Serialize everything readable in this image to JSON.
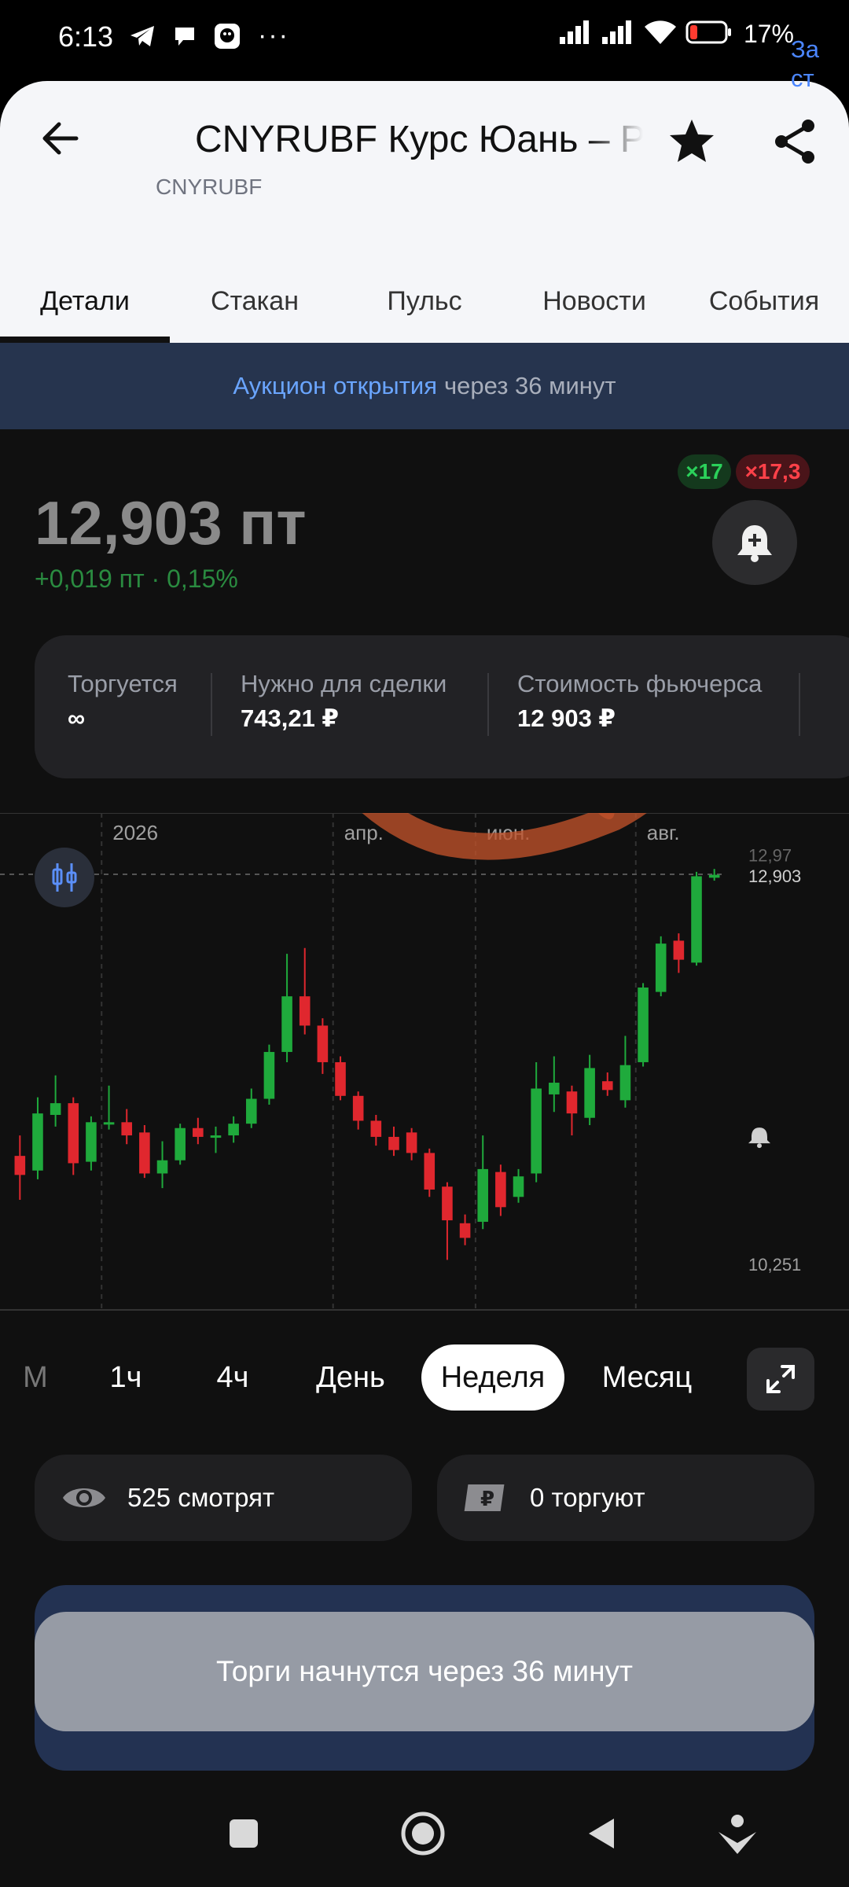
{
  "status_bar": {
    "time": "6:13",
    "battery_text": "17%",
    "icons": [
      "telegram-icon",
      "chat-bubble-icon",
      "app-icon",
      "more-dots-icon",
      "signal-icon",
      "signal-icon",
      "wifi-icon",
      "battery-icon"
    ],
    "more_dots": "···"
  },
  "header": {
    "title": "CNYRUBF Курс Юань – Р",
    "ticker": "CNYRUBF",
    "icons": [
      "arrow-left-icon",
      "star-icon",
      "share-icon"
    ]
  },
  "tabs": [
    {
      "label": "Детали",
      "active": true
    },
    {
      "label": "Стакан",
      "active": false
    },
    {
      "label": "Пульс",
      "active": false
    },
    {
      "label": "Новости",
      "active": false
    },
    {
      "label": "События",
      "active": false
    }
  ],
  "auction_banner": {
    "link_text": "Аукцион открытия",
    "rest_text": "через 36 минут"
  },
  "badges": {
    "green": "×17",
    "red": "×17,3"
  },
  "quote": {
    "price": "12,903 пт",
    "change": "+0,019 пт · 0,15%",
    "colors": {
      "price": "#8a8a8a",
      "change": "#2a8b40"
    }
  },
  "info_card": {
    "items": [
      {
        "label": "Торгуется",
        "value": "∞"
      },
      {
        "label": "Нужно для сделки",
        "value": "743,21 ₽"
      },
      {
        "label": "Стоимость фьючерса",
        "value": "12 903 ₽"
      }
    ],
    "cut_link": "За ст"
  },
  "chart_data": {
    "type": "candlestick",
    "x_labels": [
      "2026",
      "апр.",
      "июн.",
      "авг."
    ],
    "y_labels": [
      "12,97",
      "12,903",
      "10,251"
    ],
    "ylim": [
      10.1,
      13.0
    ],
    "colors": {
      "up": "#1faa3c",
      "down": "#e0272e",
      "bg": "#101010",
      "grid": "#333333"
    },
    "candles": [
      {
        "o": 10.98,
        "c": 10.85,
        "h": 11.12,
        "l": 10.68
      },
      {
        "o": 10.88,
        "c": 11.27,
        "h": 11.38,
        "l": 10.82
      },
      {
        "o": 11.26,
        "c": 11.34,
        "h": 11.53,
        "l": 11.18
      },
      {
        "o": 11.34,
        "c": 10.93,
        "h": 11.38,
        "l": 10.85
      },
      {
        "o": 10.94,
        "c": 11.21,
        "h": 11.25,
        "l": 10.88
      },
      {
        "o": 11.2,
        "c": 11.21,
        "h": 11.46,
        "l": 11.16
      },
      {
        "o": 11.21,
        "c": 11.12,
        "h": 11.3,
        "l": 11.06
      },
      {
        "o": 11.14,
        "c": 10.86,
        "h": 11.19,
        "l": 10.83
      },
      {
        "o": 10.86,
        "c": 10.95,
        "h": 11.08,
        "l": 10.76
      },
      {
        "o": 10.95,
        "c": 11.17,
        "h": 11.2,
        "l": 10.92
      },
      {
        "o": 11.17,
        "c": 11.11,
        "h": 11.24,
        "l": 11.06
      },
      {
        "o": 11.11,
        "c": 11.12,
        "h": 11.18,
        "l": 11.0
      },
      {
        "o": 11.12,
        "c": 11.2,
        "h": 11.25,
        "l": 11.07
      },
      {
        "o": 11.2,
        "c": 11.37,
        "h": 11.44,
        "l": 11.17
      },
      {
        "o": 11.37,
        "c": 11.69,
        "h": 11.74,
        "l": 11.33
      },
      {
        "o": 11.69,
        "c": 12.07,
        "h": 12.36,
        "l": 11.62
      },
      {
        "o": 12.07,
        "c": 11.87,
        "h": 12.4,
        "l": 11.81
      },
      {
        "o": 11.87,
        "c": 11.62,
        "h": 11.92,
        "l": 11.54
      },
      {
        "o": 11.62,
        "c": 11.39,
        "h": 11.66,
        "l": 11.36
      },
      {
        "o": 11.39,
        "c": 11.22,
        "h": 11.42,
        "l": 11.16
      },
      {
        "o": 11.22,
        "c": 11.11,
        "h": 11.26,
        "l": 11.05
      },
      {
        "o": 11.11,
        "c": 11.02,
        "h": 11.18,
        "l": 10.98
      },
      {
        "o": 11.14,
        "c": 11.0,
        "h": 11.17,
        "l": 10.95
      },
      {
        "o": 11.0,
        "c": 10.75,
        "h": 11.03,
        "l": 10.7
      },
      {
        "o": 10.77,
        "c": 10.54,
        "h": 10.8,
        "l": 10.27
      },
      {
        "o": 10.52,
        "c": 10.42,
        "h": 10.58,
        "l": 10.37
      },
      {
        "o": 10.53,
        "c": 10.89,
        "h": 11.12,
        "l": 10.48
      },
      {
        "o": 10.87,
        "c": 10.63,
        "h": 10.92,
        "l": 10.57
      },
      {
        "o": 10.7,
        "c": 10.84,
        "h": 10.89,
        "l": 10.66
      },
      {
        "o": 10.86,
        "c": 11.44,
        "h": 11.62,
        "l": 10.8
      },
      {
        "o": 11.4,
        "c": 11.48,
        "h": 11.66,
        "l": 11.28
      },
      {
        "o": 11.42,
        "c": 11.27,
        "h": 11.46,
        "l": 11.12
      },
      {
        "o": 11.24,
        "c": 11.58,
        "h": 11.67,
        "l": 11.19
      },
      {
        "o": 11.49,
        "c": 11.43,
        "h": 11.55,
        "l": 11.39
      },
      {
        "o": 11.36,
        "c": 11.6,
        "h": 11.8,
        "l": 11.31
      },
      {
        "o": 11.62,
        "c": 12.13,
        "h": 12.16,
        "l": 11.59
      },
      {
        "o": 12.1,
        "c": 12.43,
        "h": 12.48,
        "l": 12.07
      },
      {
        "o": 12.45,
        "c": 12.32,
        "h": 12.5,
        "l": 12.23
      },
      {
        "o": 12.3,
        "c": 12.89,
        "h": 12.92,
        "l": 12.28
      },
      {
        "o": 12.88,
        "c": 12.9,
        "h": 12.94,
        "l": 12.86
      }
    ]
  },
  "periods": [
    {
      "label": "М",
      "state": "faded"
    },
    {
      "label": "1ч",
      "state": "normal"
    },
    {
      "label": "4ч",
      "state": "normal"
    },
    {
      "label": "День",
      "state": "normal"
    },
    {
      "label": "Неделя",
      "state": "active"
    },
    {
      "label": "Месяц",
      "state": "normal"
    }
  ],
  "stats": {
    "watching": "525 смотрят",
    "trading": "0 торгуют"
  },
  "trade_button": {
    "label": "Торги начнутся через 36 минут"
  },
  "nav_icons": [
    "square-icon",
    "home-circle-icon",
    "back-triangle-icon",
    "assistant-icon"
  ]
}
